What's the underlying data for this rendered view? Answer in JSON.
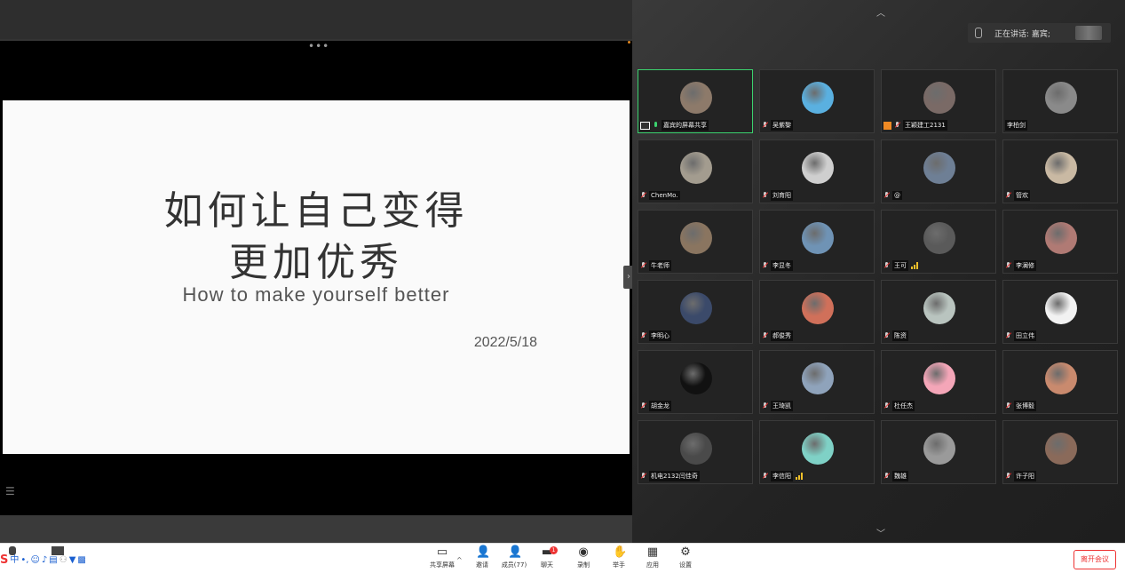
{
  "slide": {
    "title_line1": "如何让自己变得",
    "title_line2": "更加优秀",
    "subtitle": "How to make yourself better",
    "date": "2022/5/18"
  },
  "speaker": {
    "label": "正在讲话: 嘉宾;"
  },
  "participants": [
    {
      "name": "嘉宾的屏幕共享",
      "avatar_color": "#8d7a6a",
      "active": true,
      "badges": [
        "screen",
        "mic-on"
      ]
    },
    {
      "name": "吴紫黎",
      "avatar_color": "#5ab0e0",
      "badges": [
        "mic-muted"
      ]
    },
    {
      "name": "王颖建工2131",
      "avatar_color": "#7a6a66",
      "badges": [
        "orange",
        "mic-muted"
      ]
    },
    {
      "name": "李柏剑",
      "avatar_color": "#8a8a8a",
      "badges": []
    },
    {
      "name": "ChenMo.",
      "avatar_color": "#a39c8f",
      "badges": [
        "mic-muted"
      ]
    },
    {
      "name": "刘育阳",
      "avatar_color": "#cfcfcf",
      "badges": [
        "mic-muted"
      ]
    },
    {
      "name": "@",
      "avatar_color": "#6e7f95",
      "badges": [
        "mic-muted"
      ]
    },
    {
      "name": "管欢",
      "avatar_color": "#c9b9a3",
      "badges": [
        "mic-muted"
      ]
    },
    {
      "name": "牛老师",
      "avatar_color": "#8a7560",
      "badges": [
        "mic-muted"
      ]
    },
    {
      "name": "李显冬",
      "avatar_color": "#6f93b5",
      "badges": [
        "mic-muted"
      ]
    },
    {
      "name": "王可",
      "avatar_color": "#5a5a5a",
      "badges": [
        "mic-muted",
        "signal"
      ]
    },
    {
      "name": "李澜修",
      "avatar_color": "#b07a74",
      "badges": [
        "mic-muted"
      ]
    },
    {
      "name": "李明心",
      "avatar_color": "#3b4a6a",
      "badges": [
        "mic-muted"
      ]
    },
    {
      "name": "郝俊秀",
      "avatar_color": "#d0705a",
      "badges": [
        "mic-muted"
      ]
    },
    {
      "name": "陈资",
      "avatar_color": "#b9c4bf",
      "badges": [
        "mic-muted"
      ]
    },
    {
      "name": "田立伟",
      "avatar_color": "#f2f2f2",
      "badges": [
        "mic-muted"
      ]
    },
    {
      "name": "胡金龙",
      "avatar_color": "#111111",
      "badges": [
        "mic-muted"
      ]
    },
    {
      "name": "王琦凯",
      "avatar_color": "#8fa3bb",
      "badges": [
        "mic-muted"
      ]
    },
    {
      "name": "杜任杰",
      "avatar_color": "#f4a6b8",
      "badges": [
        "mic-muted"
      ]
    },
    {
      "name": "张博毅",
      "avatar_color": "#c98a6e",
      "badges": [
        "mic-muted"
      ]
    },
    {
      "name": "机电2132闫佳奇",
      "avatar_color": "#4a4a4a",
      "badges": [
        "mic-muted"
      ]
    },
    {
      "name": "李信阳",
      "avatar_color": "#7fd1c6",
      "badges": [
        "mic-muted",
        "signal"
      ]
    },
    {
      "name": "魏雄",
      "avatar_color": "#9a9a9a",
      "badges": [
        "mic-muted"
      ]
    },
    {
      "name": "许子阳",
      "avatar_color": "#8a6a5a",
      "badges": [
        "mic-muted"
      ]
    }
  ],
  "toolbar": {
    "share_screen": "共享屏幕",
    "invite": "邀请",
    "members": "成员(77)",
    "chat": "聊天",
    "chat_badge": "1",
    "record": "录制",
    "raise_hand": "举手",
    "apps": "应用",
    "settings": "设置",
    "leave": "离开会议"
  },
  "ime": {
    "lang": "中"
  }
}
